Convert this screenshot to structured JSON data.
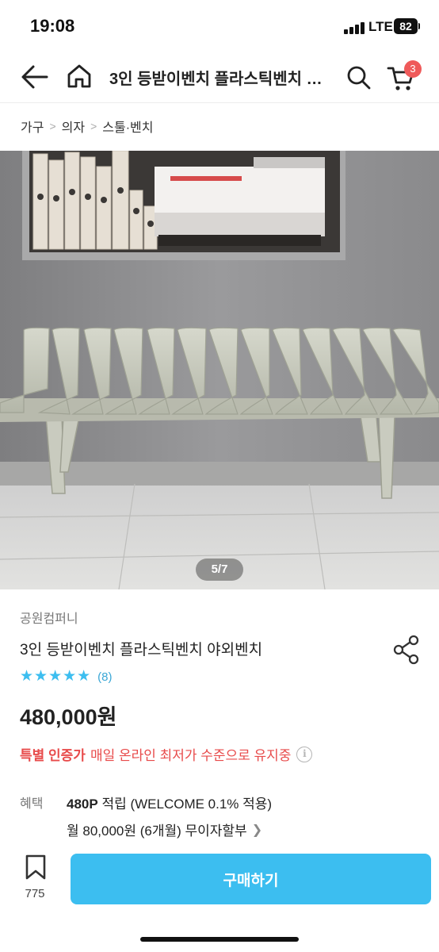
{
  "status_bar": {
    "time": "19:08",
    "network": "LTE",
    "battery": "82"
  },
  "header": {
    "title": "3인 등받이벤치 플라스틱벤치 야외벤치",
    "cart_count": "3",
    "icons": [
      "back-arrow-icon",
      "home-icon",
      "search-icon",
      "cart-icon"
    ]
  },
  "breadcrumb": [
    "가구",
    "의자",
    "스툴·벤치"
  ],
  "gallery": {
    "counter": "5/7"
  },
  "product": {
    "brand": "공원컴퍼니",
    "name": "3인 등받이벤치 플라스틱벤치 야외벤치",
    "rating": 5,
    "review_count": "(8)",
    "price": "480,000원"
  },
  "promo": {
    "highlight": "특별 인증가",
    "text": "매일 온라인 최저가 수준으로 유지중"
  },
  "benefits": {
    "label": "혜택",
    "points": "480P",
    "points_text": "적립 (WELCOME 0.1% 적용)",
    "installment": "월 80,000원 (6개월) 무이자할부"
  },
  "bottom_bar": {
    "bookmark_count": "775",
    "buy_label": "구매하기"
  },
  "colors": {
    "accent": "#3cbef0",
    "promo_red": "#e84b4b",
    "badge_red": "#ef5a5a"
  }
}
